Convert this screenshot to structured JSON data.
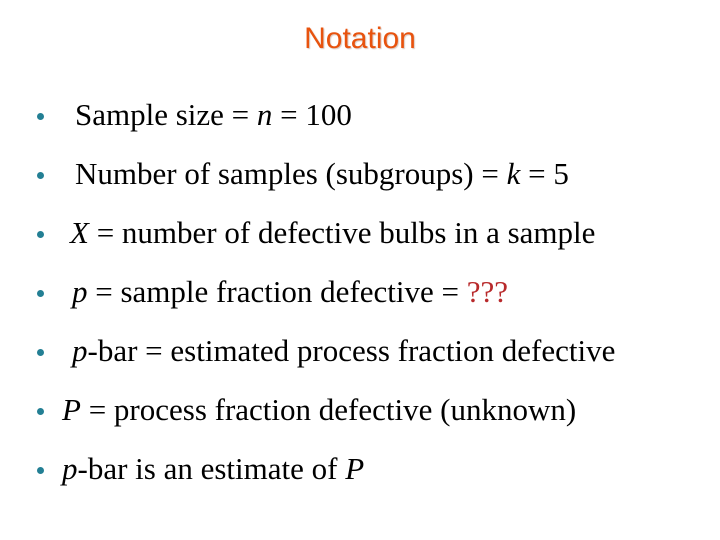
{
  "title": "Notation",
  "colors": {
    "title": "#e8530e",
    "bullet": "#237f94",
    "highlight": "#b8292b"
  },
  "items": [
    {
      "parts": [
        "Sample size = ",
        "n",
        " = 100"
      ]
    },
    {
      "parts": [
        "Number of samples (subgroups) = ",
        "k",
        " = 5"
      ]
    },
    {
      "parts": [
        "X",
        " = number of defective bulbs in a sample"
      ]
    },
    {
      "parts": [
        "p",
        " = sample fraction defective = ",
        "???"
      ]
    },
    {
      "parts": [
        "p",
        "-bar = estimated process fraction defective"
      ]
    },
    {
      "parts": [
        "P",
        " = process fraction defective (unknown)"
      ]
    },
    {
      "parts": [
        "p",
        "-bar is an estimate of ",
        "P"
      ]
    }
  ]
}
